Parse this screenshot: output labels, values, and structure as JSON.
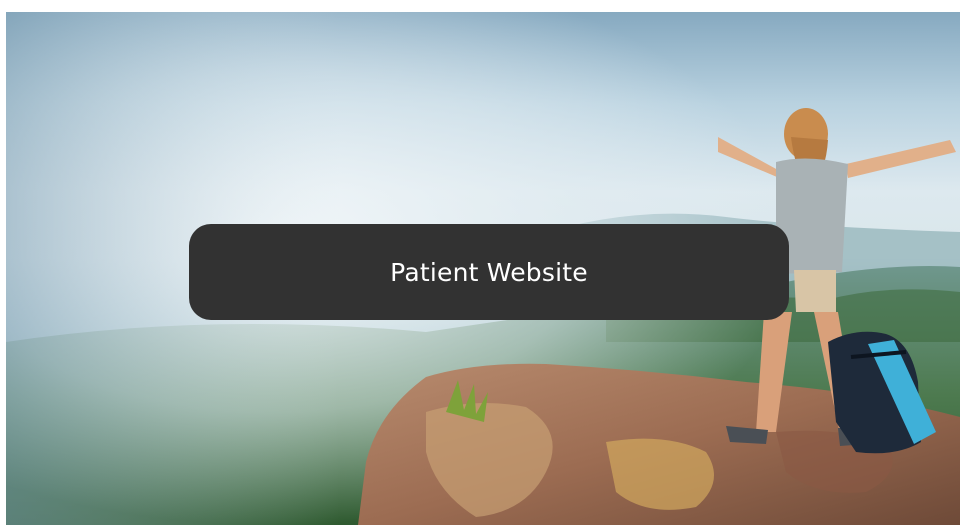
{
  "hero": {
    "image_description_icon": "mountain-cliff-hiker-icon"
  },
  "cta": {
    "label": "Patient Website"
  },
  "colors": {
    "button_background": "#323232",
    "button_text": "#ffffff",
    "page_background": "#ffffff"
  }
}
